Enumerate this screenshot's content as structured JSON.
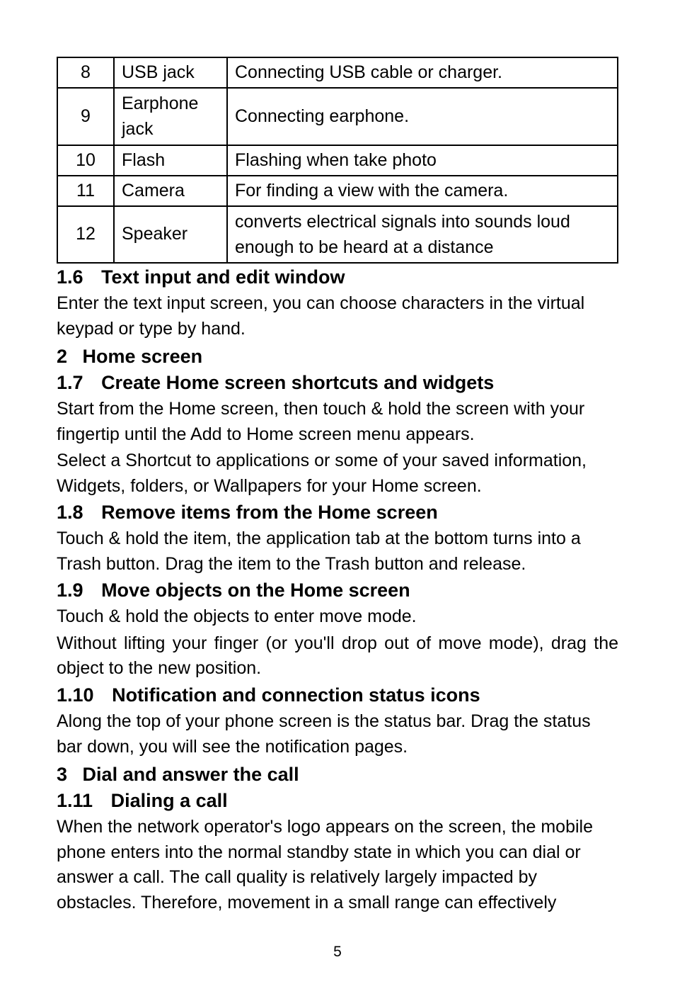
{
  "table": {
    "rows": [
      {
        "num": "8",
        "label": "USB jack",
        "desc": "Connecting USB cable or charger."
      },
      {
        "num": "9",
        "label": "Earphone jack",
        "desc": "Connecting earphone."
      },
      {
        "num": "10",
        "label": "Flash",
        "desc": "Flashing when take photo"
      },
      {
        "num": "11",
        "label": "Camera",
        "desc": "For finding a view with the camera."
      },
      {
        "num": "12",
        "label": "Speaker",
        "desc": "converts electrical signals into sounds loud enough to be heard at a distance"
      }
    ]
  },
  "sections": {
    "s1_6": {
      "num": "1.6",
      "title": "Text input and edit window",
      "body": "Enter the text input screen, you can choose characters in the virtual keypad or type by hand."
    },
    "s2": {
      "num": "2",
      "title": "Home screen"
    },
    "s1_7": {
      "num": "1.7",
      "title": "Create Home screen shortcuts and widgets",
      "body1": "Start from the Home screen, then touch & hold the screen with your fingertip until the Add to Home screen menu appears.",
      "body2": "Select a Shortcut to applications or some of your saved information, Widgets, folders, or Wallpapers for your Home screen."
    },
    "s1_8": {
      "num": "1.8",
      "title": "Remove items from the Home screen",
      "body": "Touch & hold the item, the application tab at the bottom turns into a Trash button. Drag the item to the Trash button and release."
    },
    "s1_9": {
      "num": "1.9",
      "title": "Move objects on the Home screen",
      "body1": "Touch & hold the objects to enter move mode.",
      "body2": "Without lifting your finger (or you'll drop out of move mode), drag the object to the new position."
    },
    "s1_10": {
      "num": "1.10",
      "title": "Notification and connection status icons",
      "body": "Along the top of your phone screen is the status bar. Drag the status bar down, you will see the notification pages."
    },
    "s3": {
      "num": "3",
      "title": "Dial and answer the call"
    },
    "s1_11": {
      "num": "1.11",
      "title": "Dialing a call",
      "body": "When the network operator's logo appears on the screen, the mobile phone enters into the normal standby state in which you can dial or answer a call. The call quality is relatively largely impacted by obstacles. Therefore, movement in a small range can effectively"
    }
  },
  "page_number": "5"
}
